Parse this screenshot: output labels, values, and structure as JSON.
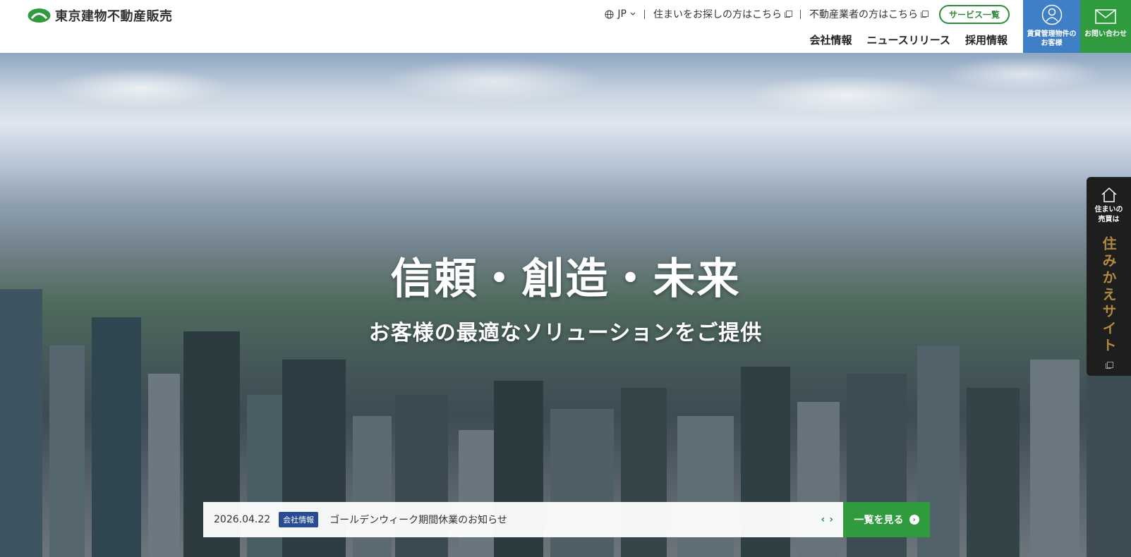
{
  "header": {
    "logo_text": "東京建物不動産販売",
    "util": {
      "lang": "JP",
      "link1": "住まいをお探しの方はこちら",
      "link2": "不動産業者の方はこちら",
      "service_button": "サービス一覧"
    },
    "nav": [
      "会社情報",
      "ニュースリリース",
      "採用情報"
    ],
    "tiles": {
      "rental_line1": "賃貸管理物件の",
      "rental_line2": "お客様",
      "contact": "お問い合わせ"
    }
  },
  "hero": {
    "headline": "信頼・創造・未来",
    "subline": "お客様の最適なソリューションをご提供"
  },
  "news": {
    "date": "2026.04.22",
    "category": "会社情報",
    "title": "ゴールデンウィーク期間休業のお知らせ",
    "more_label": "一覧を見る"
  },
  "sidetab": {
    "small_line1": "住まいの",
    "small_line2": "売買は",
    "vertical": "住みかえサイト"
  },
  "colors": {
    "brand_green": "#2f9a3e",
    "rental_blue": "#3f7fc6",
    "category_navy": "#2a4b91",
    "sidetab_gold": "#b08a3e"
  }
}
